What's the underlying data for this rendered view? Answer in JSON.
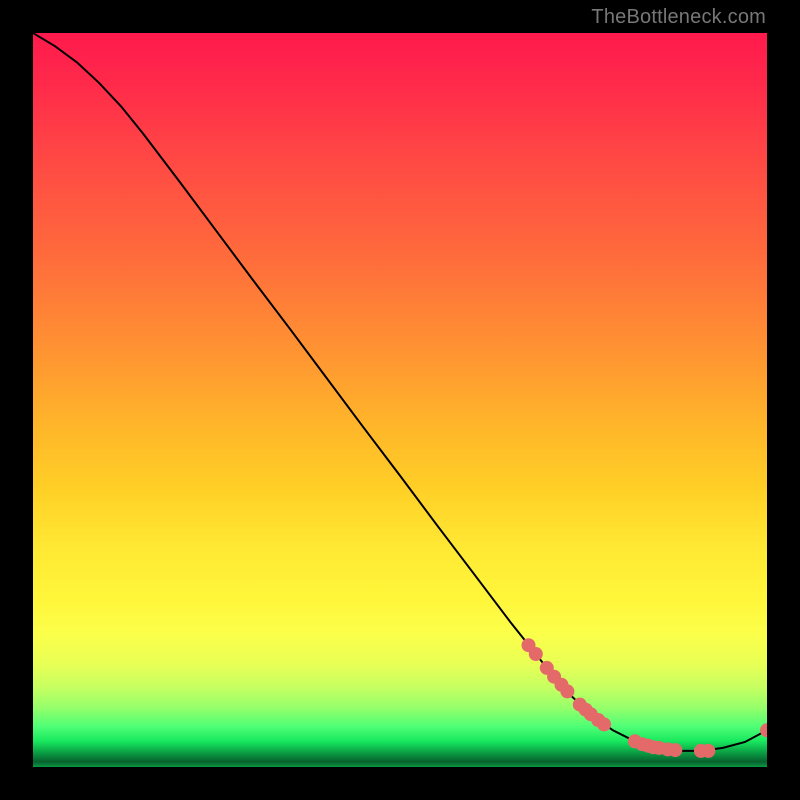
{
  "watermark": "TheBottleneck.com",
  "colors": {
    "curve": "#000000",
    "marker_fill": "#e46a6a",
    "marker_stroke": "#c94f4f"
  },
  "chart_data": {
    "type": "line",
    "title": "",
    "xlabel": "",
    "ylabel": "",
    "xlim": [
      0,
      100
    ],
    "ylim": [
      0,
      100
    ],
    "grid": false,
    "legend": false,
    "series": [
      {
        "name": "curve",
        "x": [
          0,
          3,
          6,
          9,
          12,
          15,
          20,
          25,
          30,
          35,
          40,
          45,
          50,
          55,
          60,
          65,
          70,
          73,
          76,
          79,
          82,
          85,
          88,
          91,
          94,
          97,
          100
        ],
        "y": [
          100,
          98.2,
          96.0,
          93.2,
          90.0,
          86.3,
          79.7,
          73.0,
          66.3,
          59.7,
          53.0,
          46.3,
          39.7,
          33.0,
          26.4,
          19.8,
          13.5,
          10.0,
          7.2,
          5.0,
          3.5,
          2.6,
          2.2,
          2.2,
          2.6,
          3.4,
          5.0
        ]
      }
    ],
    "markers": {
      "name": "highlight-points",
      "x": [
        67.5,
        68.5,
        70.0,
        71.0,
        72.0,
        72.8,
        74.5,
        75.3,
        76.0,
        77.0,
        77.8,
        82.0,
        83.0,
        83.8,
        84.5,
        85.3,
        86.5,
        87.5,
        91.0,
        92.0,
        100.0
      ],
      "y": [
        16.6,
        15.4,
        13.5,
        12.3,
        11.2,
        10.3,
        8.5,
        7.8,
        7.2,
        6.4,
        5.8,
        3.5,
        3.1,
        2.9,
        2.7,
        2.6,
        2.4,
        2.3,
        2.2,
        2.2,
        5.0
      ]
    }
  }
}
